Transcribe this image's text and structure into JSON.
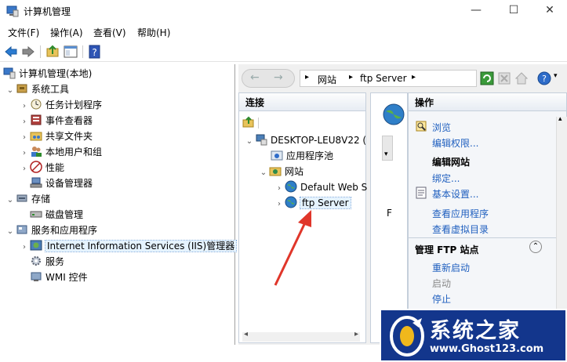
{
  "window": {
    "title": "计算机管理",
    "minimize": "—",
    "maximize": "☐",
    "close": "✕"
  },
  "menu": [
    "文件(F)",
    "操作(A)",
    "查看(V)",
    "帮助(H)"
  ],
  "tree": {
    "root": "计算机管理(本地)",
    "system_tools": "系统工具",
    "task_scheduler": "任务计划程序",
    "event_viewer": "事件查看器",
    "shared_folders": "共享文件夹",
    "local_users": "本地用户和组",
    "performance": "性能",
    "device_manager": "设备管理器",
    "storage": "存储",
    "disk_management": "磁盘管理",
    "services_apps": "服务和应用程序",
    "iis_manager": "Internet Information Services (IIS)管理器",
    "services": "服务",
    "wmi": "WMI 控件"
  },
  "iis": {
    "address": {
      "site": "网站",
      "server": "ftp Server"
    },
    "connections": {
      "header": "连接",
      "host": "DESKTOP-LEU8V22 (",
      "app_pools": "应用程序池",
      "sites": "网站",
      "default_site": "Default Web S",
      "ftp_server": "ftp Server"
    },
    "features_letter": "F",
    "actions": {
      "header": "操作",
      "browse": "浏览",
      "edit_permissions": "编辑权限...",
      "edit_site": "编辑网站",
      "bindings": "绑定...",
      "basic_settings": "基本设置...",
      "view_apps": "查看应用程序",
      "view_vdirs": "查看虚拟目录",
      "manage_ftp": "管理 FTP 站点",
      "restart": "重新启动",
      "start": "启动",
      "stop": "停止"
    }
  },
  "watermark": {
    "name": "系统之家",
    "url": "www.Ghost123.com"
  },
  "colors": {
    "link": "#1f5fbf",
    "selection": "#e5f3ff",
    "arrow": "#e0362a",
    "watermark_bg": "#13368c"
  }
}
